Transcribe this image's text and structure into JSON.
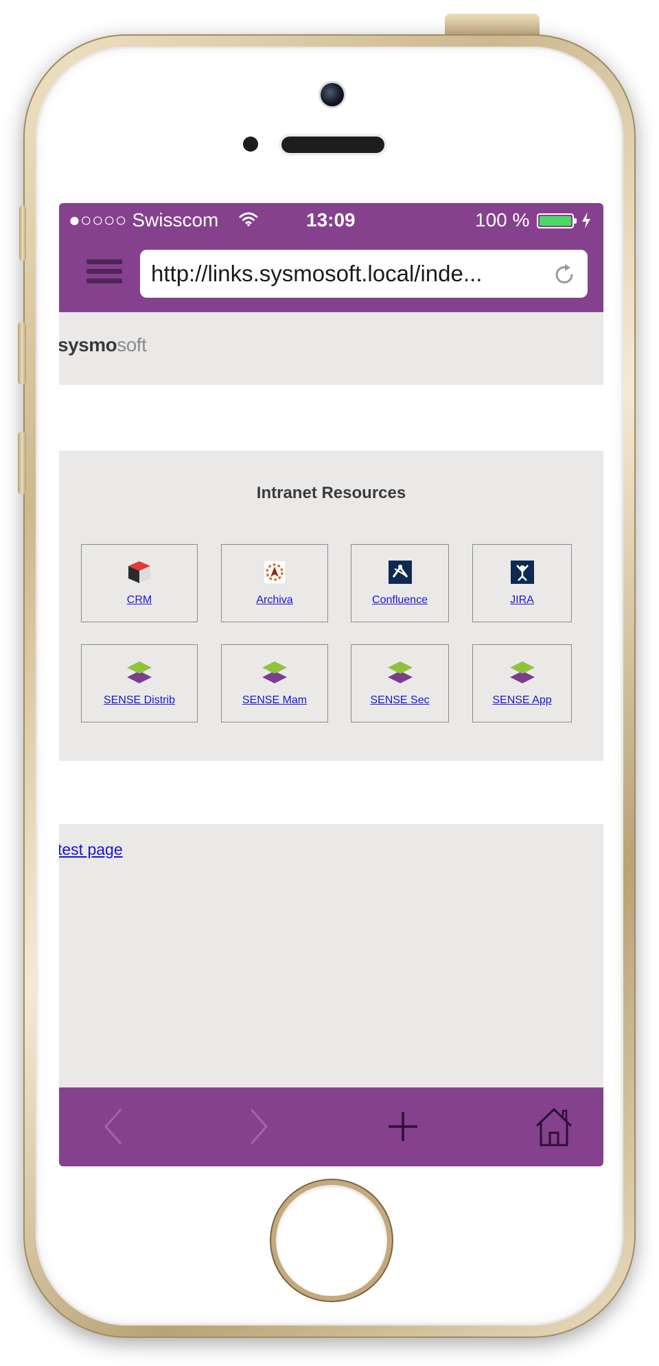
{
  "status_bar": {
    "carrier": "●○○○○ Swisscom",
    "time": "13:09",
    "battery": "100 %",
    "icons": [
      "wifi-icon",
      "battery-icon",
      "charging-icon"
    ]
  },
  "browser": {
    "url": "http://links.sysmosoft.local/inde...",
    "icons": [
      "menu-icon",
      "reload-icon"
    ]
  },
  "page": {
    "logo": {
      "bold": "sysmo",
      "light": "soft"
    },
    "section_title": "Intranet Resources",
    "tiles": [
      {
        "label": "CRM",
        "icon": "crm-cube-icon"
      },
      {
        "label": "Archiva",
        "icon": "archiva-icon"
      },
      {
        "label": "Confluence",
        "icon": "confluence-icon"
      },
      {
        "label": "JIRA",
        "icon": "jira-icon"
      },
      {
        "label": "SENSE Distrib",
        "icon": "sense-layers-icon"
      },
      {
        "label": "SENSE Mam",
        "icon": "sense-layers-icon"
      },
      {
        "label": "SENSE Sec",
        "icon": "sense-layers-icon"
      },
      {
        "label": "SENSE App",
        "icon": "sense-layers-icon"
      }
    ],
    "test_link": "test page"
  },
  "bottom_bar": {
    "icons": [
      "back-icon",
      "forward-icon",
      "add-tab-icon",
      "home-icon"
    ]
  },
  "colors": {
    "accent": "#85418d",
    "page_bg": "#ebe9e8",
    "link": "#1515d8"
  }
}
